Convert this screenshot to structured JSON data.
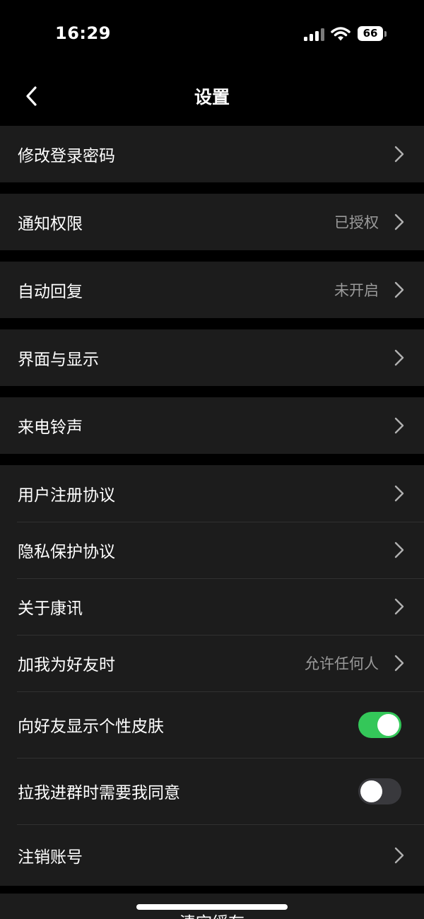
{
  "status_bar": {
    "time": "16:29",
    "battery_level": "66"
  },
  "nav": {
    "title": "设置"
  },
  "groups": [
    {
      "rows": [
        {
          "label": "修改登录密码",
          "value": ""
        }
      ]
    },
    {
      "rows": [
        {
          "label": "通知权限",
          "value": "已授权"
        }
      ]
    },
    {
      "rows": [
        {
          "label": "自动回复",
          "value": "未开启"
        }
      ]
    },
    {
      "rows": [
        {
          "label": "界面与显示",
          "value": ""
        }
      ]
    },
    {
      "rows": [
        {
          "label": "来电铃声",
          "value": ""
        }
      ]
    },
    {
      "rows": [
        {
          "label": "用户注册协议",
          "value": ""
        },
        {
          "label": "隐私保护协议",
          "value": ""
        },
        {
          "label": "关于康讯",
          "value": ""
        },
        {
          "label": "加我为好友时",
          "value": "允许任何人"
        },
        {
          "label": "向好友显示个性皮肤",
          "toggle": true
        },
        {
          "label": "拉我进群时需要我同意",
          "toggle": false
        },
        {
          "label": "注销账号",
          "value": ""
        }
      ]
    }
  ],
  "bottom": {
    "label": "清空缓存"
  },
  "colors": {
    "background": "#000000",
    "row_background": "#1c1c1c",
    "toggle_on": "#34c759",
    "toggle_off": "#39393d",
    "secondary_text": "#9a9a9a"
  },
  "icons": {
    "back": "chevron-left-icon",
    "row_arrow": "chevron-right-icon",
    "signal": "cellular-signal-icon",
    "wifi": "wifi-icon",
    "battery": "battery-icon"
  }
}
